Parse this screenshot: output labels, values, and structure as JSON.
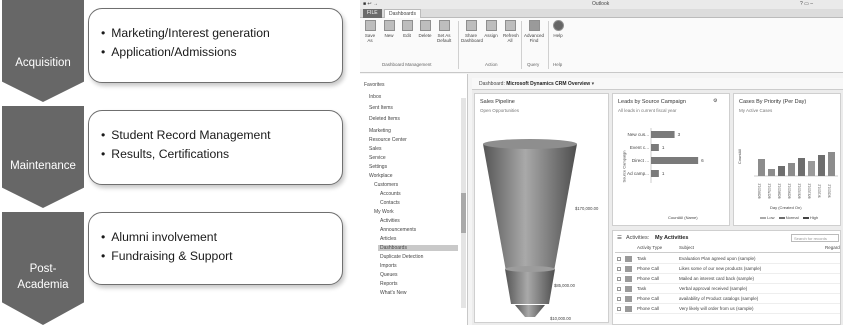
{
  "stages": [
    {
      "label": "Acquisition",
      "bullets": [
        "Marketing/Interest generation",
        "Application/Admissions"
      ]
    },
    {
      "label": "Maintenance",
      "bullets": [
        "Student Record Management",
        "Results, Certifications"
      ]
    },
    {
      "label": "Post-Academia",
      "bullets": [
        "Alumni involvement",
        "Fundraising & Support"
      ]
    }
  ],
  "app": {
    "window_title": "Outlook",
    "tabs": [
      "FILE",
      "Dashboards"
    ],
    "ribbon": {
      "buttons": [
        "Save As",
        "New",
        "Edit",
        "Delete",
        "Set As Default",
        "Share Dashboard",
        "Assign",
        "Refresh All",
        "Advanced Find",
        "Help"
      ],
      "groups": [
        "Dashboard Management",
        "Action",
        "Query",
        "Help"
      ]
    },
    "nav": {
      "favorites": "Favorites",
      "fav_items": [
        "Inbox",
        "Sent Items",
        "Deleted Items"
      ],
      "sections": [
        "Marketing",
        "Resource Center",
        "Sales",
        "Service",
        "Settings",
        "Workplace"
      ],
      "customers": "Customers",
      "customer_items": [
        "Accounts",
        "Contacts"
      ],
      "mywork": "My Work",
      "mywork_items": [
        "Activities",
        "Announcements",
        "Articles",
        "Dashboards",
        "Duplicate Detection",
        "Imports",
        "Queues",
        "Reports",
        "What's New"
      ]
    },
    "dashboard": {
      "label": "Dashboard:",
      "name": "Microsoft Dynamics CRM Overview",
      "pipeline": {
        "title": "Sales Pipeline",
        "subtitle": "Open Opportunities",
        "values": [
          "$170,000.00",
          "$85,000.00",
          "$10,000.00"
        ]
      },
      "leads": {
        "title": "Leads by Source Campaign",
        "subtitle": "All leads in current fiscal year",
        "ylabel": "Source Campaign",
        "xlabel": "CountAll (Name)",
        "chart_data": {
          "type": "bar",
          "categories": [
            "New cus...",
            "Event c...",
            "Direct ...",
            "Ad camp..."
          ],
          "values": [
            3,
            1,
            6,
            1
          ]
        }
      },
      "cases": {
        "title": "Cases By Priority (Per Day)",
        "subtitle": "My Active Cases",
        "ylabel": "CountAll",
        "xlabel": "Day (Created On)",
        "legend": [
          "Low",
          "Normal",
          "High"
        ],
        "dates": [
          "8/26/2012",
          "8/27/2012",
          "8/28/2012",
          "8/29/2012",
          "8/30/2012",
          "8/31/2012",
          "9/1/2012",
          "9/2/2012"
        ]
      },
      "activities": {
        "label": "Activities:",
        "view": "My Activities",
        "search": "Search for records",
        "columns": [
          "Activity Type",
          "Subject",
          "Regard"
        ],
        "rows": [
          {
            "type": "Task",
            "subject": "Evaluation Plan agreed upon (sample)"
          },
          {
            "type": "Phone Call",
            "subject": "Likes some of our new products (sample)"
          },
          {
            "type": "Phone Call",
            "subject": "Mailed an interest card back (sample)"
          },
          {
            "type": "Task",
            "subject": "Verbal approval received (sample)"
          },
          {
            "type": "Phone Call",
            "subject": "availability of Product catalogs (sample)"
          },
          {
            "type": "Phone Call",
            "subject": "Very likely will order from us (sample)"
          }
        ]
      }
    }
  }
}
